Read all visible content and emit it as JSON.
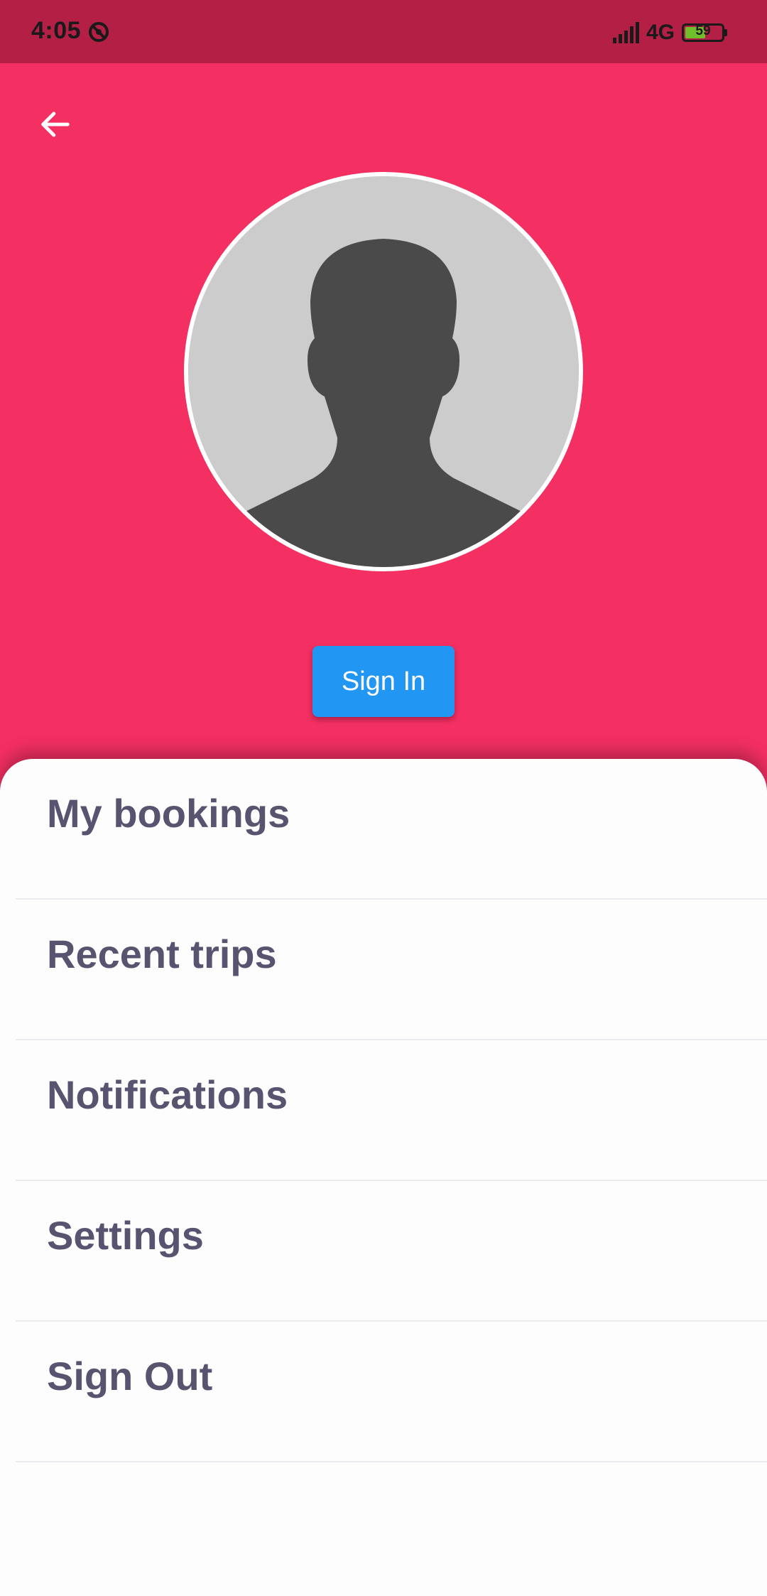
{
  "status_bar": {
    "time": "4:05",
    "network": "4G",
    "battery_level": "59",
    "battery_fraction": 0.59
  },
  "header": {
    "back_icon": "arrow-left-icon",
    "avatar_icon": "person-silhouette-icon",
    "sign_in_label": "Sign In"
  },
  "menu": {
    "items": [
      {
        "label": "My bookings"
      },
      {
        "label": "Recent trips"
      },
      {
        "label": "Notifications"
      },
      {
        "label": "Settings"
      },
      {
        "label": "Sign Out"
      }
    ]
  },
  "colors": {
    "status_bar": "#b41f46",
    "header": "#f42f62",
    "button": "#2196f3",
    "menu_text": "#585470",
    "sheet": "#fdfdfe"
  }
}
